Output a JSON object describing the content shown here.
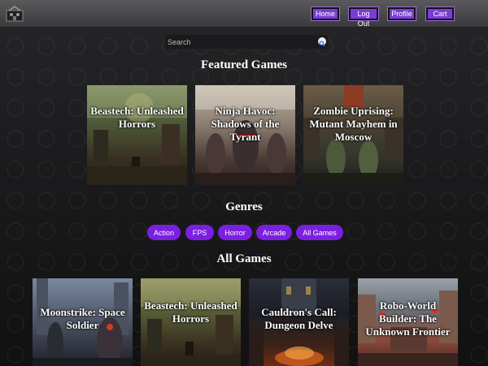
{
  "nav": {
    "home": "Home",
    "logout": "Log Out",
    "profile": "Profile",
    "cart": "Cart"
  },
  "search": {
    "placeholder": "Search"
  },
  "featured": {
    "title": "Featured Games",
    "games": [
      {
        "title": "Beastech: Unleashed Horrors"
      },
      {
        "title": "Ninja Havoc: Shadows of the Tyrant"
      },
      {
        "title": "Zombie Uprising: Mutant Mayhem in Moscow"
      }
    ]
  },
  "genres": {
    "title": "Genres",
    "items": [
      "Action",
      "FPS",
      "Horror",
      "Arcade",
      "All Games"
    ]
  },
  "all_games": {
    "title": "All Games",
    "games": [
      {
        "title": "Moonstrike: Space Soldier"
      },
      {
        "title": "Beastech: Unleashed Horrors"
      },
      {
        "title": "Cauldron's Call: Dungeon Delve"
      },
      {
        "title": "Robo-World Builder: The Unknown Frontier"
      }
    ]
  },
  "colors": {
    "accent": "#7b1fe0",
    "nav_button": "#7a3cd6",
    "header": "#4a4a4c"
  },
  "icons": {
    "logo": "logo-icon",
    "search": "search-icon"
  }
}
